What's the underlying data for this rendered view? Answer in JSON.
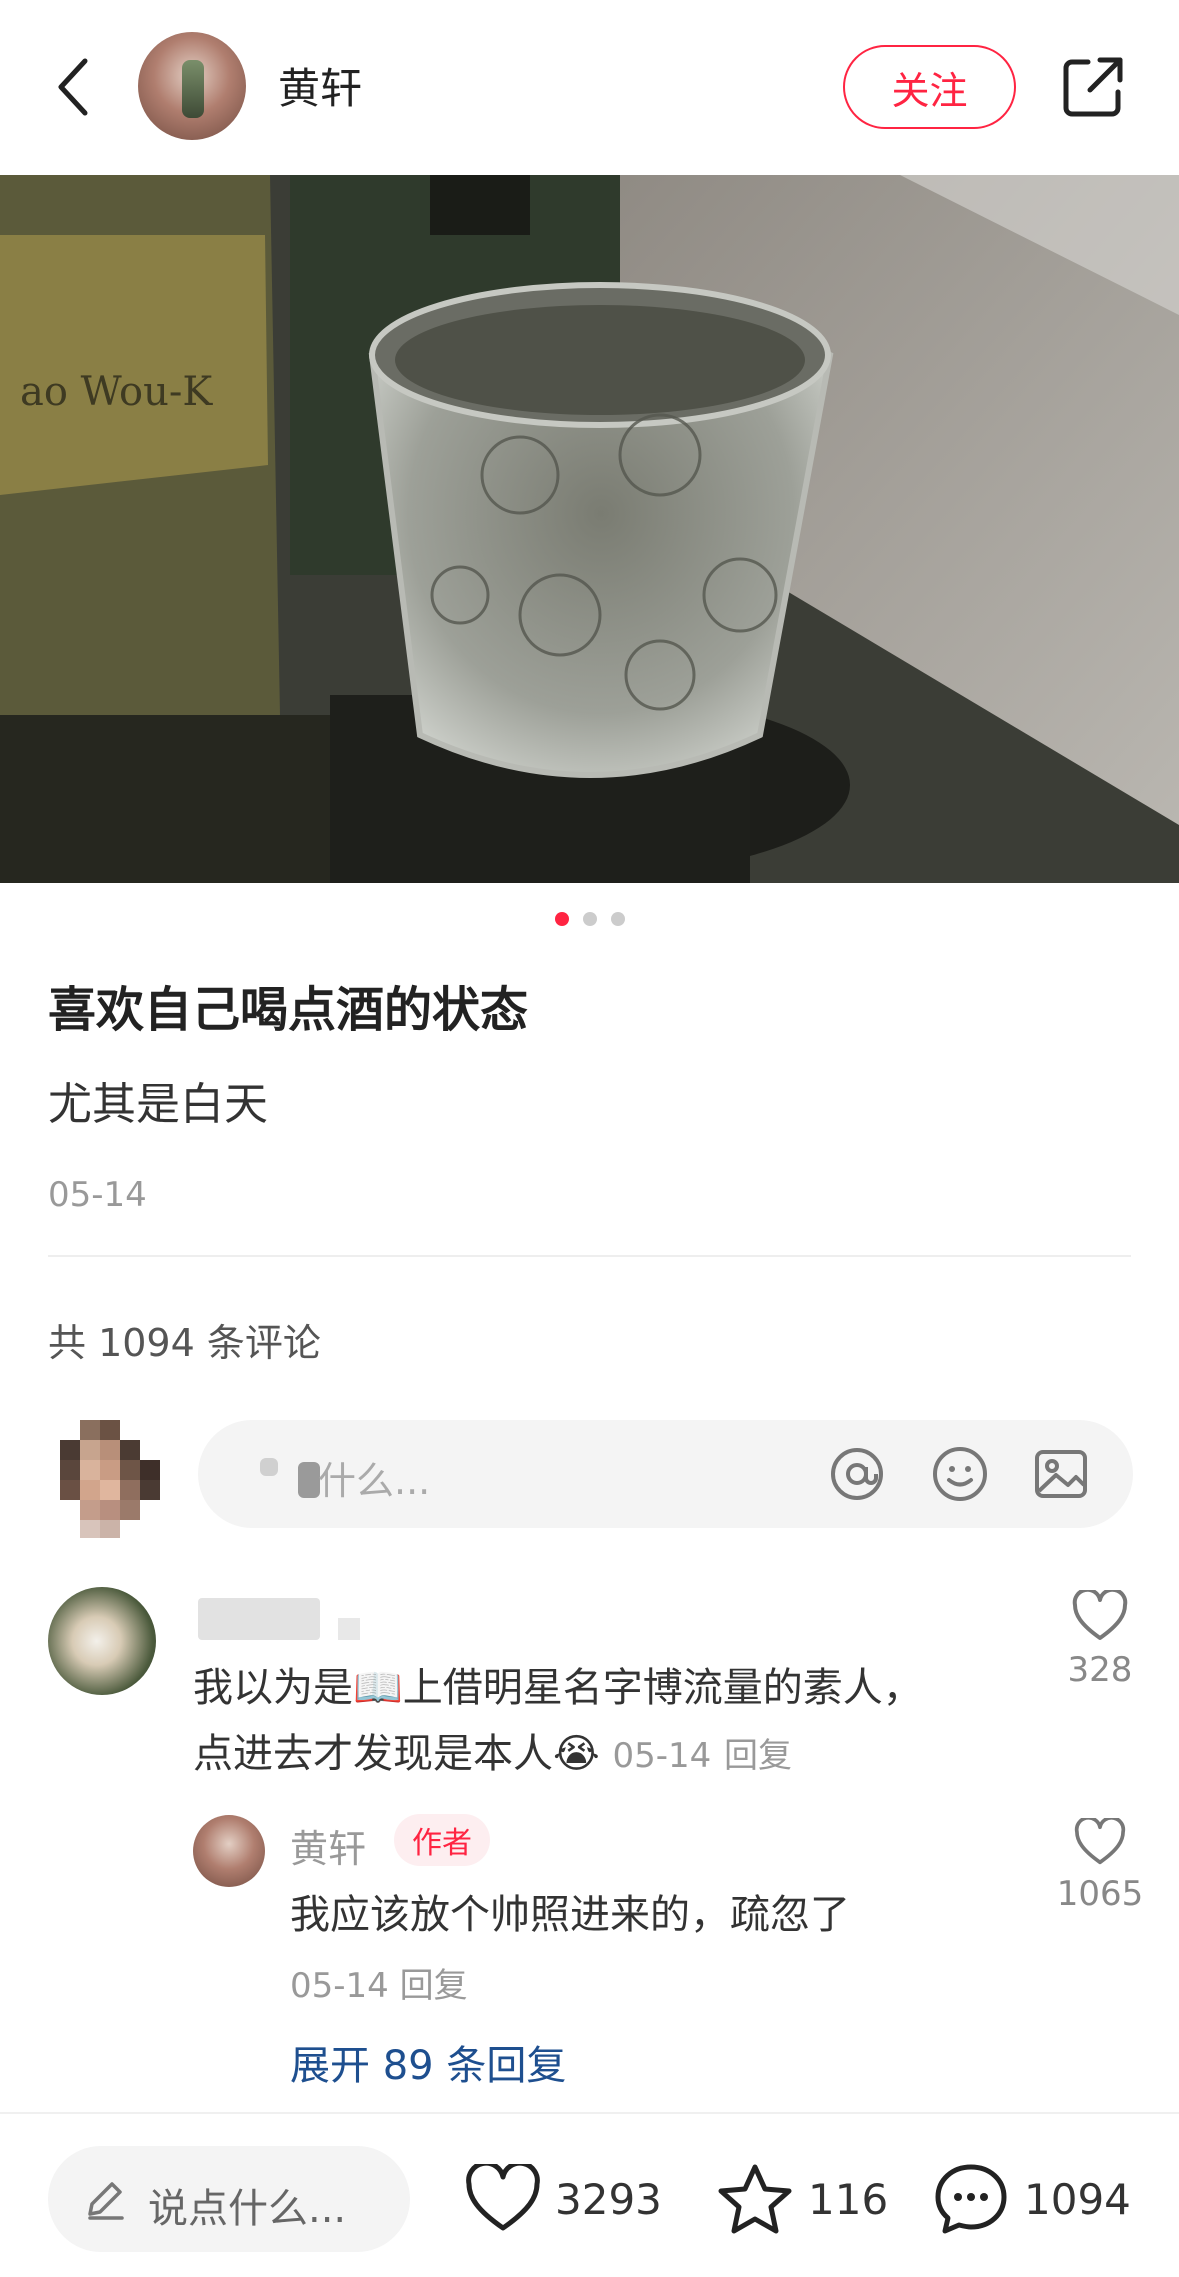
{
  "header": {
    "user_name": "黄轩",
    "follow_label": "关注"
  },
  "carousel": {
    "total": 3,
    "active_index": 0
  },
  "post": {
    "title": "喜欢自己喝点酒的状态",
    "body": "尤其是白天",
    "date": "05-14"
  },
  "comments_section": {
    "count_label": "共 1094 条评论",
    "input_placeholder": "什么..."
  },
  "comment": {
    "text_line1": "我以为是📖上借明星名字博流量的素人，",
    "text_line2": "点进去才发现是本人😭",
    "date": "05-14",
    "reply_label": "回复",
    "likes": "328"
  },
  "reply": {
    "user_name": "黄轩",
    "author_tag": "作者",
    "text": "我应该放个帅照进来的，疏忽了",
    "date": "05-14",
    "reply_label": "回复",
    "likes": "1065"
  },
  "expand_label": "展开 89 条回复",
  "bottom_bar": {
    "say_placeholder": "说点什么...",
    "likes": "3293",
    "collects": "116",
    "comments": "1094"
  },
  "colors": {
    "accent": "#ff2442",
    "link": "#1e4f8f"
  }
}
